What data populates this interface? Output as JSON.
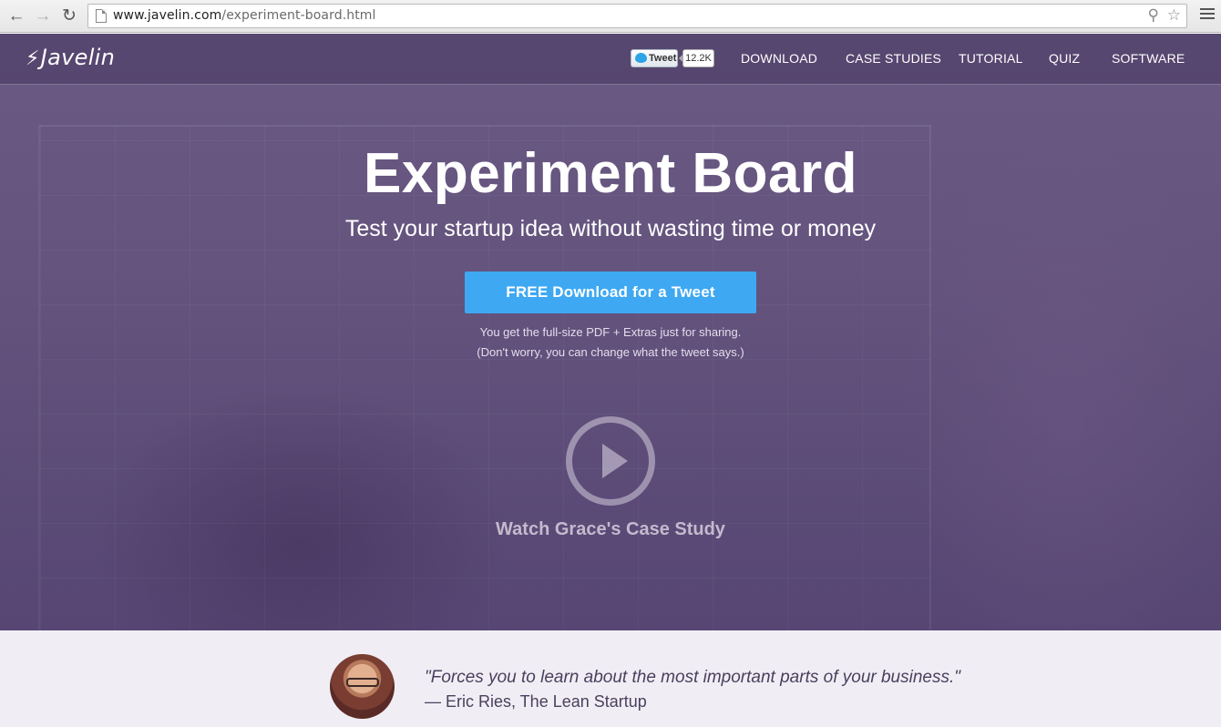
{
  "browser": {
    "url_host": "www.javelin.com",
    "url_path": "/experiment-board.html",
    "back_icon": "←",
    "forward_icon": "→",
    "reload_icon": "↻",
    "search_icon": "⚲",
    "star_icon": "☆"
  },
  "nav": {
    "logo_icon": "⚡",
    "logo_text": "Javelin",
    "tweet_label": "Tweet",
    "tweet_count": "12.2K",
    "items": [
      "DOWNLOAD",
      "CASE STUDIES",
      "TUTORIAL",
      "QUIZ",
      "SOFTWARE"
    ]
  },
  "hero": {
    "title": "Experiment Board",
    "subtitle": "Test your startup idea without wasting time or money",
    "cta_label": "FREE Download for a Tweet",
    "note_line1": "You get the full-size PDF + Extras just for sharing.",
    "note_line2": "(Don't worry, you can change what the tweet says.)",
    "video_label": "Watch Grace's Case Study"
  },
  "testimonial": {
    "quote": "\"Forces you to learn about the most important parts of your business.\"",
    "author": "— Eric Ries, The Lean Startup"
  },
  "colors": {
    "accent": "#3ea8f2",
    "hero_overlay": "#6a5a82",
    "testimonial_bg": "#f0eef4"
  }
}
